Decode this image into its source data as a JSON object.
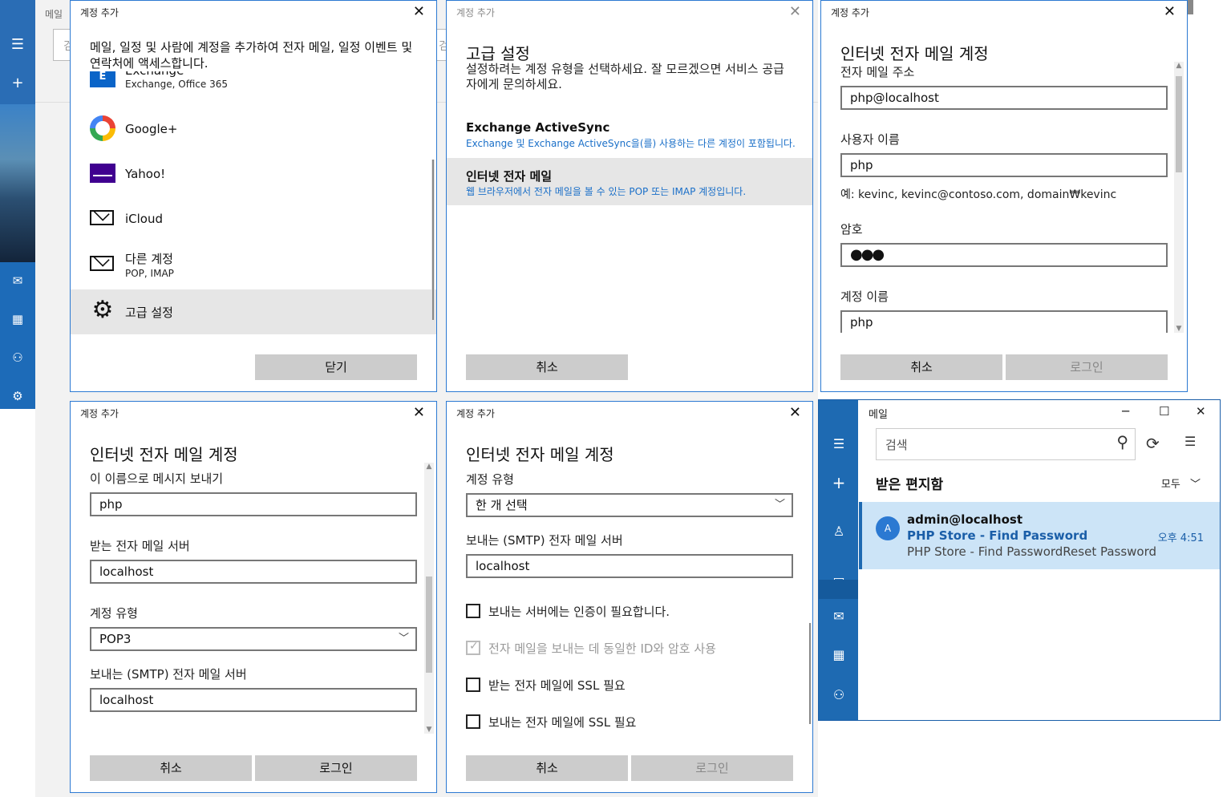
{
  "background": {
    "mail_label": "메일",
    "search_placeholder": "검"
  },
  "dialog_title": "계정 추가",
  "dialog1": {
    "intro": "메일, 일정 및 사람에 계정을 추가하여 전자 메일, 일정 이벤트 및 연락처에 액세스합니다.",
    "accounts": [
      {
        "name": "Exchange",
        "sub": "Exchange, Office 365",
        "icon": "exchange-icon"
      },
      {
        "name": "Google+",
        "sub": "",
        "icon": "google-icon"
      },
      {
        "name": "Yahoo!",
        "sub": "",
        "icon": "yahoo-icon"
      },
      {
        "name": "iCloud",
        "sub": "",
        "icon": "mail-icon"
      },
      {
        "name": "다른 계정",
        "sub": "POP, IMAP",
        "icon": "mail-icon"
      },
      {
        "name": "고급 설정",
        "sub": "",
        "icon": "gear-icon"
      }
    ],
    "close_button": "닫기"
  },
  "dialog2": {
    "heading": "고급 설정",
    "description": "설정하려는 계정 유형을 선택하세요. 잘 모르겠으면 서비스 공급자에게 문의하세요.",
    "options": [
      {
        "title": "Exchange ActiveSync",
        "desc": "Exchange 및 Exchange ActiveSync을(를) 사용하는 다른 계정이 포함됩니다."
      },
      {
        "title": "인터넷 전자 메일",
        "desc": "웹 브라우저에서 전자 메일을 볼 수 있는 POP 또는 IMAP 계정입니다."
      }
    ],
    "cancel_button": "취소"
  },
  "dialog3": {
    "heading": "인터넷 전자 메일 계정",
    "email_label": "전자 메일 주소",
    "email_value": "php@localhost",
    "username_label": "사용자 이름",
    "username_value": "php",
    "username_hint": "예: kevinc, kevinc@contoso.com, domain₩kevinc",
    "password_label": "암호",
    "password_value": "●●●",
    "account_name_label": "계정 이름",
    "account_name_value": "php",
    "cancel_button": "취소",
    "login_button": "로그인"
  },
  "dialog4": {
    "heading": "인터넷 전자 메일 계정",
    "sender_name_label": "이 이름으로 메시지 보내기",
    "sender_name_value": "php",
    "incoming_label": "받는 전자 메일 서버",
    "incoming_value": "localhost",
    "account_type_label": "계정 유형",
    "account_type_value": "POP3",
    "smtp_label": "보내는 (SMTP) 전자 메일 서버",
    "smtp_value": "localhost",
    "cancel_button": "취소",
    "login_button": "로그인"
  },
  "dialog5": {
    "heading": "인터넷 전자 메일 계정",
    "account_type_label": "계정 유형",
    "account_type_value": "한 개 선택",
    "smtp_label": "보내는 (SMTP) 전자 메일 서버",
    "smtp_value": "localhost",
    "checks": [
      {
        "label": "보내는 서버에는 인증이 필요합니다.",
        "checked": false,
        "disabled": false
      },
      {
        "label": "전자 메일을 보내는 데 동일한 ID와 암호 사용",
        "checked": true,
        "disabled": true
      },
      {
        "label": "받는 전자 메일에 SSL 필요",
        "checked": false,
        "disabled": false
      },
      {
        "label": "보내는 전자 메일에 SSL 필요",
        "checked": false,
        "disabled": false
      }
    ],
    "cancel_button": "취소",
    "login_button": "로그인"
  },
  "mail_window": {
    "title": "메일",
    "search_placeholder": "검색",
    "folder": "받은 편지함",
    "filter": "모두",
    "message": {
      "avatar": "A",
      "from": "admin@localhost",
      "subject": "PHP Store - Find Password",
      "time": "오후 4:51",
      "preview": "PHP Store - Find PasswordReset Password"
    }
  },
  "colors": {
    "accent": "#2b79d2",
    "rail": "#1e6ab2",
    "selected_message": "#cce4f7",
    "button_gray": "#cccccc"
  }
}
